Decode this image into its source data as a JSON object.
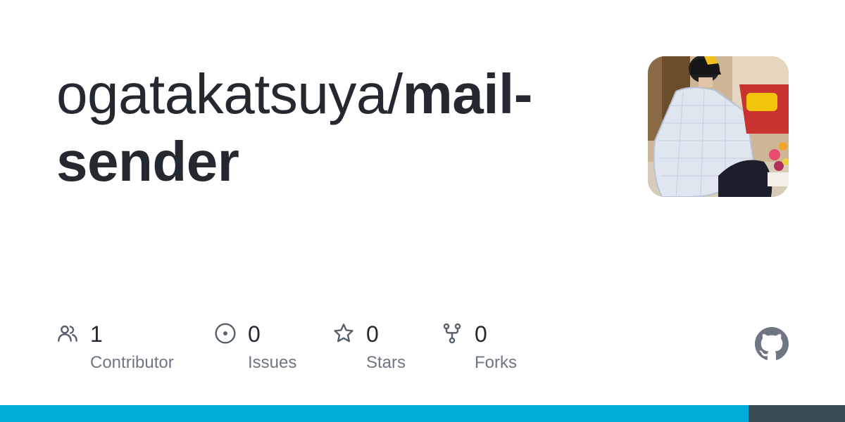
{
  "repo": {
    "owner": "ogatakatsuya/",
    "name": "mail-sender"
  },
  "stats": [
    {
      "count": "1",
      "label": "Contributor",
      "icon": "people-icon"
    },
    {
      "count": "0",
      "label": "Issues",
      "icon": "issue-opened-icon"
    },
    {
      "count": "0",
      "label": "Stars",
      "icon": "star-icon"
    },
    {
      "count": "0",
      "label": "Forks",
      "icon": "repo-forked-icon"
    }
  ],
  "colors": {
    "text": "#24292f",
    "muted": "#6e7781",
    "icon": "#57606a",
    "bar_primary": "#00add8",
    "bar_secondary": "#384d54"
  },
  "language_bar": [
    {
      "color": "#00add8",
      "fraction": 0.886
    },
    {
      "color": "#384d54",
      "fraction": 0.114
    }
  ]
}
